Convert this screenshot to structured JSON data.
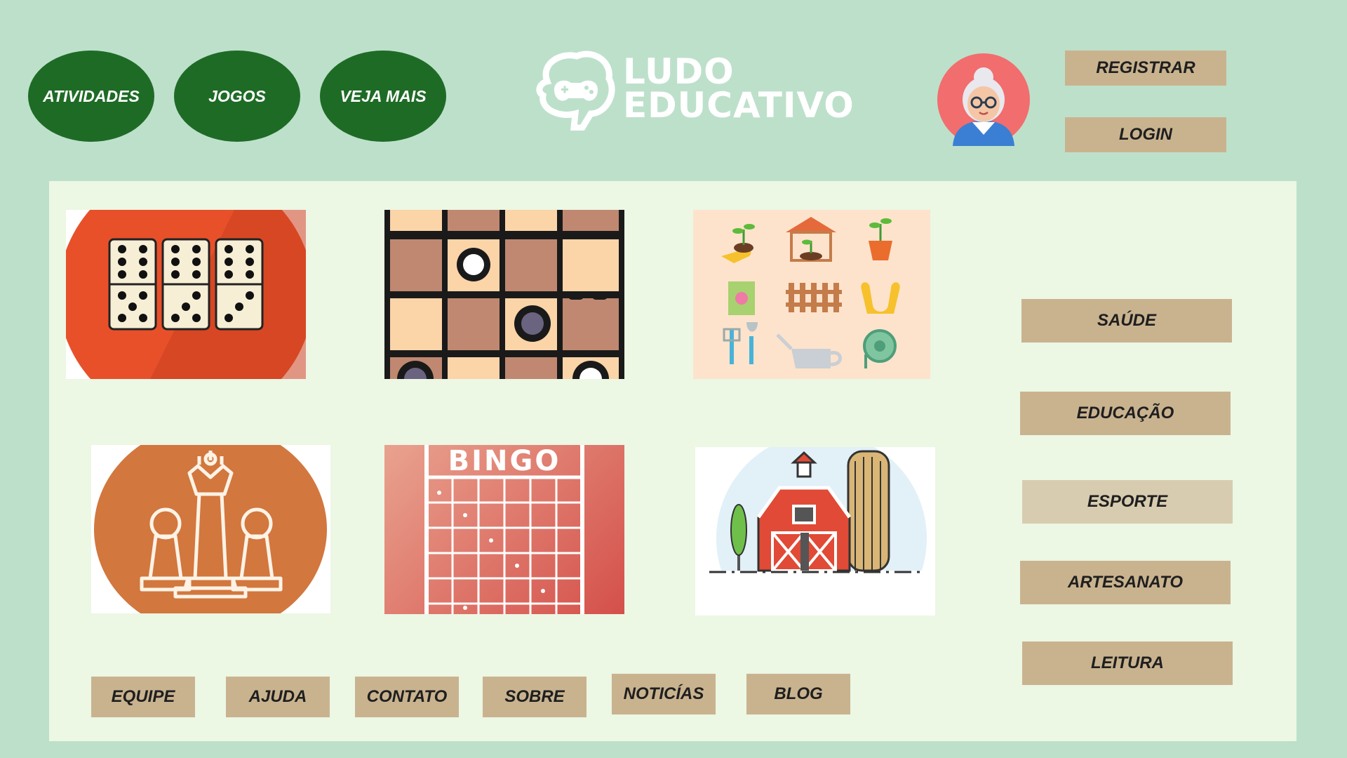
{
  "nav": {
    "atividades": "ATIVIDADES",
    "jogos": "JOGOS",
    "veja_mais": "VEJA MAIS"
  },
  "logo": {
    "line1": "LUDO",
    "line2": "EDUCATIVO"
  },
  "auth": {
    "register": "REGISTRAR",
    "login": "LOGIN"
  },
  "games": {
    "bingo_label": "BINGO",
    "tiles": [
      "domino-icon",
      "checkers-board-icon",
      "gardening-icons",
      "chess-pieces-icon",
      "bingo-card-icon",
      "farm-barn-icon"
    ]
  },
  "categories": {
    "saude": "SAÚDE",
    "educacao": "EDUCAÇÃO",
    "esporte": "ESPORTE",
    "artesanato": "ARTESANATO",
    "leitura": "LEITURA"
  },
  "footer": {
    "equipe": "EQUIPE",
    "ajuda": "AJUDA",
    "contato": "CONTATO",
    "sobre": "SOBRE",
    "noticias": "NOTICÍAS",
    "blog": "BLOG"
  },
  "colors": {
    "background": "#bde0cb",
    "panel": "#ecf7e4",
    "nav_green": "#1e6b26",
    "tan_button": "#c9b38f",
    "tan_light": "#d8ccb0"
  }
}
